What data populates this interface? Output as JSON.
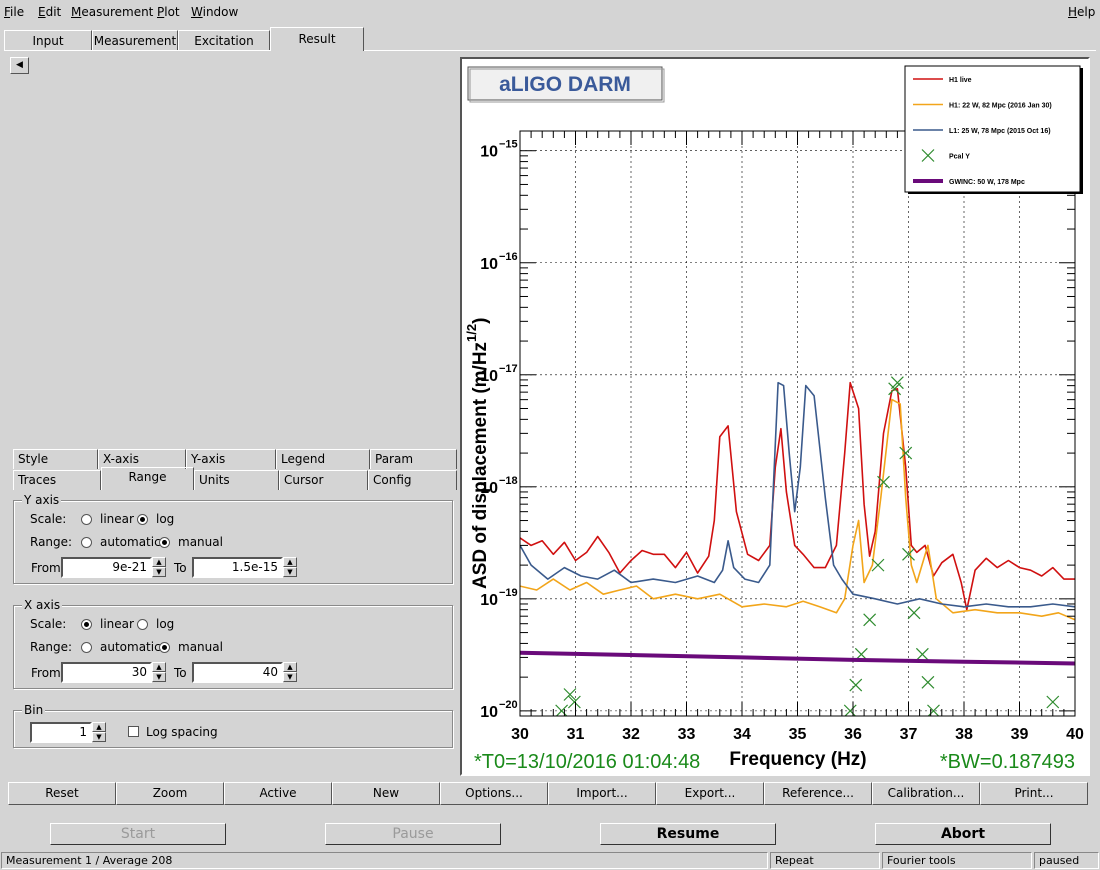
{
  "menu": {
    "file": "ile",
    "file_ul": "F",
    "edit": "dit",
    "edit_ul": "E",
    "measurement": "easurement",
    "measurement_ul": "M",
    "plot": "lot",
    "plot_ul": "P",
    "window": "indow",
    "window_ul": "W",
    "help": "elp",
    "help_ul": "H"
  },
  "tabs": [
    "Input",
    "Measurement",
    "Excitation",
    "Result"
  ],
  "active_tab": "Result",
  "sub_tabs_row1": [
    "Style",
    "X-axis",
    "Y-axis",
    "Legend",
    "Param"
  ],
  "sub_tabs_row2": [
    "Traces",
    "Range",
    "Units",
    "Cursor",
    "Config"
  ],
  "yaxis": {
    "title": "Y axis",
    "scale_label": "Scale:",
    "scale_linear": "linear",
    "scale_log": "log",
    "scale_selected": "log",
    "range_label": "Range:",
    "range_auto": "automatic",
    "range_manual": "manual",
    "range_selected": "manual",
    "from_label": "From",
    "from_value": "9e-21",
    "to_label": "To",
    "to_value": "1.5e-15"
  },
  "xaxis": {
    "title": "X axis",
    "scale_label": "Scale:",
    "scale_linear": "linear",
    "scale_log": "log",
    "scale_selected": "linear",
    "range_label": "Range:",
    "range_auto": "automatic",
    "range_manual": "manual",
    "range_selected": "manual",
    "from_label": "From",
    "from_value": "30",
    "to_label": "To",
    "to_value": "40"
  },
  "bin": {
    "title": "Bin",
    "value": "1",
    "log_spacing_label": "Log spacing",
    "log_spacing": false
  },
  "toolbar": [
    "Reset",
    "Zoom",
    "Active",
    "New",
    "Options...",
    "Import...",
    "Export...",
    "Reference...",
    "Calibration...",
    "Print..."
  ],
  "actions": {
    "start": "Start",
    "pause": "Pause",
    "resume": "Resume",
    "abort": "Abort"
  },
  "status": {
    "measurement": "Measurement 1 / Average 208",
    "repeat": "Repeat",
    "tool": "Fourier tools",
    "state": "paused"
  },
  "chart_data": {
    "type": "line",
    "title": "aLIGO DARM",
    "xlabel": "Frequency (Hz)",
    "ylabel_main": "ASD of displacement (m/Hz",
    "ylabel_exp": "1/2",
    "ylabel_close": ")",
    "xlim": [
      30,
      40
    ],
    "ylim": [
      9e-21,
      1.5e-15
    ],
    "yscale": "log",
    "grid": true,
    "legend_position": "top-right",
    "x_ticks": [
      "30",
      "31",
      "32",
      "33",
      "34",
      "35",
      "36",
      "37",
      "38",
      "39",
      "40"
    ],
    "y_ticks": [
      {
        "exp": -15,
        "base": "10",
        "sup": "−15"
      },
      {
        "exp": -16,
        "base": "10",
        "sup": "−16"
      },
      {
        "exp": -17,
        "base": "10",
        "sup": "−17"
      },
      {
        "exp": -18,
        "base": "10",
        "sup": "−18"
      },
      {
        "exp": -19,
        "base": "10",
        "sup": "−19"
      },
      {
        "exp": -20,
        "base": "10",
        "sup": "−20"
      }
    ],
    "annotation_left": "*T0=13/10/2016 01:04:48",
    "annotation_right": "*BW=0.187493",
    "colors": {
      "h1_live": "#d01010",
      "h1_ref": "#f2a51a",
      "l1_ref": "#3a5a8c",
      "pcal": "#2e8b2e",
      "gwinc": "#6a0a7a",
      "title_text": "#3a5a9a",
      "annotation": "#1a8a1a"
    },
    "series": [
      {
        "name": "H1 live",
        "key": "h1_live",
        "points": [
          [
            30,
            3.5e-19
          ],
          [
            30.2,
            3e-19
          ],
          [
            30.4,
            3.3e-19
          ],
          [
            30.6,
            2.5e-19
          ],
          [
            30.8,
            3.2e-19
          ],
          [
            31,
            2.2e-19
          ],
          [
            31.2,
            2.6e-19
          ],
          [
            31.4,
            3.6e-19
          ],
          [
            31.6,
            2.6e-19
          ],
          [
            31.8,
            1.7e-19
          ],
          [
            32,
            2.2e-19
          ],
          [
            32.2,
            2.7e-19
          ],
          [
            32.4,
            2.5e-19
          ],
          [
            32.6,
            2.5e-19
          ],
          [
            32.8,
            1.9e-19
          ],
          [
            33,
            2.6e-19
          ],
          [
            33.2,
            1.7e-19
          ],
          [
            33.4,
            2.4e-19
          ],
          [
            33.5,
            5e-19
          ],
          [
            33.6,
            2.8e-18
          ],
          [
            33.75,
            3.5e-18
          ],
          [
            33.9,
            6e-19
          ],
          [
            34.1,
            2.5e-19
          ],
          [
            34.3,
            2.2e-19
          ],
          [
            34.5,
            3e-19
          ],
          [
            34.6,
            1.5e-18
          ],
          [
            34.7,
            3.3e-18
          ],
          [
            34.8,
            9e-19
          ],
          [
            34.95,
            3e-19
          ],
          [
            35.1,
            2.5e-19
          ],
          [
            35.3,
            1.9e-19
          ],
          [
            35.5,
            1.9e-19
          ],
          [
            35.7,
            3e-19
          ],
          [
            35.85,
            2e-18
          ],
          [
            35.95,
            8.5e-18
          ],
          [
            36.1,
            5e-18
          ],
          [
            36.2,
            7e-19
          ],
          [
            36.3,
            2.4e-19
          ],
          [
            36.4,
            4e-19
          ],
          [
            36.55,
            3e-18
          ],
          [
            36.7,
            7.2e-18
          ],
          [
            36.8,
            7.5e-18
          ],
          [
            36.95,
            1.5e-18
          ],
          [
            37.05,
            3e-19
          ],
          [
            37.15,
            2.6e-19
          ],
          [
            37.3,
            3e-19
          ],
          [
            37.45,
            1.6e-19
          ],
          [
            37.6,
            2.1e-19
          ],
          [
            37.8,
            2.5e-19
          ],
          [
            37.95,
            1.4e-19
          ],
          [
            38.05,
            8e-20
          ],
          [
            38.2,
            1.8e-19
          ],
          [
            38.4,
            2.3e-19
          ],
          [
            38.6,
            1.9e-19
          ],
          [
            38.8,
            2.2e-19
          ],
          [
            39,
            1.9e-19
          ],
          [
            39.2,
            1.8e-19
          ],
          [
            39.4,
            1.6e-19
          ],
          [
            39.6,
            1.9e-19
          ],
          [
            39.8,
            1.5e-19
          ],
          [
            40,
            1.5e-19
          ]
        ]
      },
      {
        "name": "H1: 22 W, 82 Mpc (2016 Jan 30)",
        "key": "h1_ref",
        "points": [
          [
            30,
            1.3e-19
          ],
          [
            30.3,
            1.2e-19
          ],
          [
            30.6,
            1.5e-19
          ],
          [
            30.9,
            1.2e-19
          ],
          [
            31.2,
            1.4e-19
          ],
          [
            31.5,
            1.1e-19
          ],
          [
            31.8,
            1.2e-19
          ],
          [
            32.1,
            1.3e-19
          ],
          [
            32.4,
            1e-19
          ],
          [
            32.8,
            1.1e-19
          ],
          [
            33.2,
            1e-19
          ],
          [
            33.6,
            1.1e-19
          ],
          [
            34,
            8.5e-20
          ],
          [
            34.4,
            9e-20
          ],
          [
            34.8,
            8.5e-20
          ],
          [
            35.1,
            9.5e-20
          ],
          [
            35.4,
            8.5e-20
          ],
          [
            35.7,
            7.5e-20
          ],
          [
            35.85,
            1e-19
          ],
          [
            36,
            3e-19
          ],
          [
            36.1,
            5e-19
          ],
          [
            36.2,
            1.4e-19
          ],
          [
            36.35,
            2e-19
          ],
          [
            36.5,
            8e-19
          ],
          [
            36.7,
            6e-18
          ],
          [
            36.85,
            5.5e-18
          ],
          [
            36.95,
            8e-19
          ],
          [
            37.05,
            2e-19
          ],
          [
            37.15,
            1.4e-19
          ],
          [
            37.35,
            3e-19
          ],
          [
            37.5,
            1e-19
          ],
          [
            37.8,
            7.5e-20
          ],
          [
            38.2,
            8e-20
          ],
          [
            38.6,
            7.5e-20
          ],
          [
            39,
            7.5e-20
          ],
          [
            39.4,
            7e-20
          ],
          [
            39.7,
            7.5e-20
          ],
          [
            40,
            6.5e-20
          ]
        ]
      },
      {
        "name": "L1: 25 W, 78 Mpc (2015 Oct 16)",
        "key": "l1_ref",
        "points": [
          [
            30,
            3e-19
          ],
          [
            30.2,
            2e-19
          ],
          [
            30.5,
            1.5e-19
          ],
          [
            30.8,
            1.9e-19
          ],
          [
            31.1,
            1.6e-19
          ],
          [
            31.4,
            1.5e-19
          ],
          [
            31.7,
            1.8e-19
          ],
          [
            32,
            1.4e-19
          ],
          [
            32.4,
            1.5e-19
          ],
          [
            32.8,
            1.4e-19
          ],
          [
            33.2,
            1.6e-19
          ],
          [
            33.5,
            1.4e-19
          ],
          [
            33.65,
            1.8e-19
          ],
          [
            33.75,
            3.3e-19
          ],
          [
            33.85,
            1.9e-19
          ],
          [
            34.05,
            1.5e-19
          ],
          [
            34.3,
            1.4e-19
          ],
          [
            34.5,
            2e-19
          ],
          [
            34.65,
            8.5e-18
          ],
          [
            34.75,
            8e-18
          ],
          [
            34.85,
            2e-18
          ],
          [
            34.95,
            6e-19
          ],
          [
            35.05,
            1.5e-18
          ],
          [
            35.15,
            8e-18
          ],
          [
            35.3,
            6.5e-18
          ],
          [
            35.5,
            8e-19
          ],
          [
            35.65,
            2e-19
          ],
          [
            35.8,
            1.5e-19
          ],
          [
            36,
            1.1e-19
          ],
          [
            36.4,
            1e-19
          ],
          [
            36.8,
            9e-20
          ],
          [
            37.2,
            1e-19
          ],
          [
            37.6,
            9e-20
          ],
          [
            38,
            8.5e-20
          ],
          [
            38.4,
            9e-20
          ],
          [
            38.8,
            8.5e-20
          ],
          [
            39.2,
            8.5e-20
          ],
          [
            39.6,
            9e-20
          ],
          [
            40,
            8.5e-20
          ]
        ]
      },
      {
        "name": "Pcal Y",
        "key": "pcal",
        "marker": "x",
        "points": [
          [
            30.75,
            1e-20
          ],
          [
            30.9,
            1.4e-20
          ],
          [
            30.98,
            1.2e-20
          ],
          [
            35.95,
            1e-20
          ],
          [
            36.05,
            1.7e-20
          ],
          [
            36.15,
            3.2e-20
          ],
          [
            36.3,
            6.5e-20
          ],
          [
            36.45,
            2e-19
          ],
          [
            36.55,
            1.1e-18
          ],
          [
            36.75,
            7.5e-18
          ],
          [
            36.8,
            8.5e-18
          ],
          [
            36.95,
            2e-18
          ],
          [
            37.0,
            2.5e-19
          ],
          [
            37.1,
            7.5e-20
          ],
          [
            37.25,
            3.2e-20
          ],
          [
            37.35,
            1.8e-20
          ],
          [
            37.45,
            1e-20
          ],
          [
            39.6,
            1.2e-20
          ]
        ]
      },
      {
        "name": "GWINC: 50 W, 178 Mpc",
        "key": "gwinc",
        "thick": true,
        "points": [
          [
            30,
            3.3e-20
          ],
          [
            32,
            3.15e-20
          ],
          [
            34,
            3e-20
          ],
          [
            36,
            2.85e-20
          ],
          [
            38,
            2.75e-20
          ],
          [
            40,
            2.65e-20
          ]
        ]
      }
    ]
  }
}
